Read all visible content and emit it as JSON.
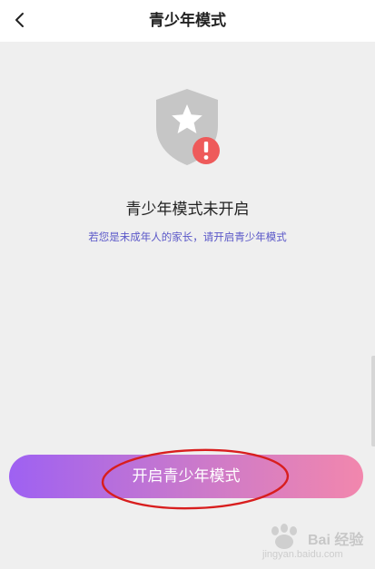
{
  "header": {
    "title": "青少年模式",
    "back_icon": "chevron-left-icon"
  },
  "status": {
    "icon": "shield-star-warning-icon",
    "title": "青少年模式未开启",
    "hint": "若您是未成年人的家长，请开启青少年模式"
  },
  "action": {
    "enable_label": "开启青少年模式"
  },
  "watermark": {
    "brand": "Bai 经验",
    "url": "jingyan.baidu.com"
  },
  "colors": {
    "hint_text": "#5a57c8",
    "button_gradient_start": "#9e61f2",
    "button_gradient_end": "#f287ad",
    "warning_badge": "#ee5a5a",
    "annotation_circle": "#d81e1e"
  }
}
